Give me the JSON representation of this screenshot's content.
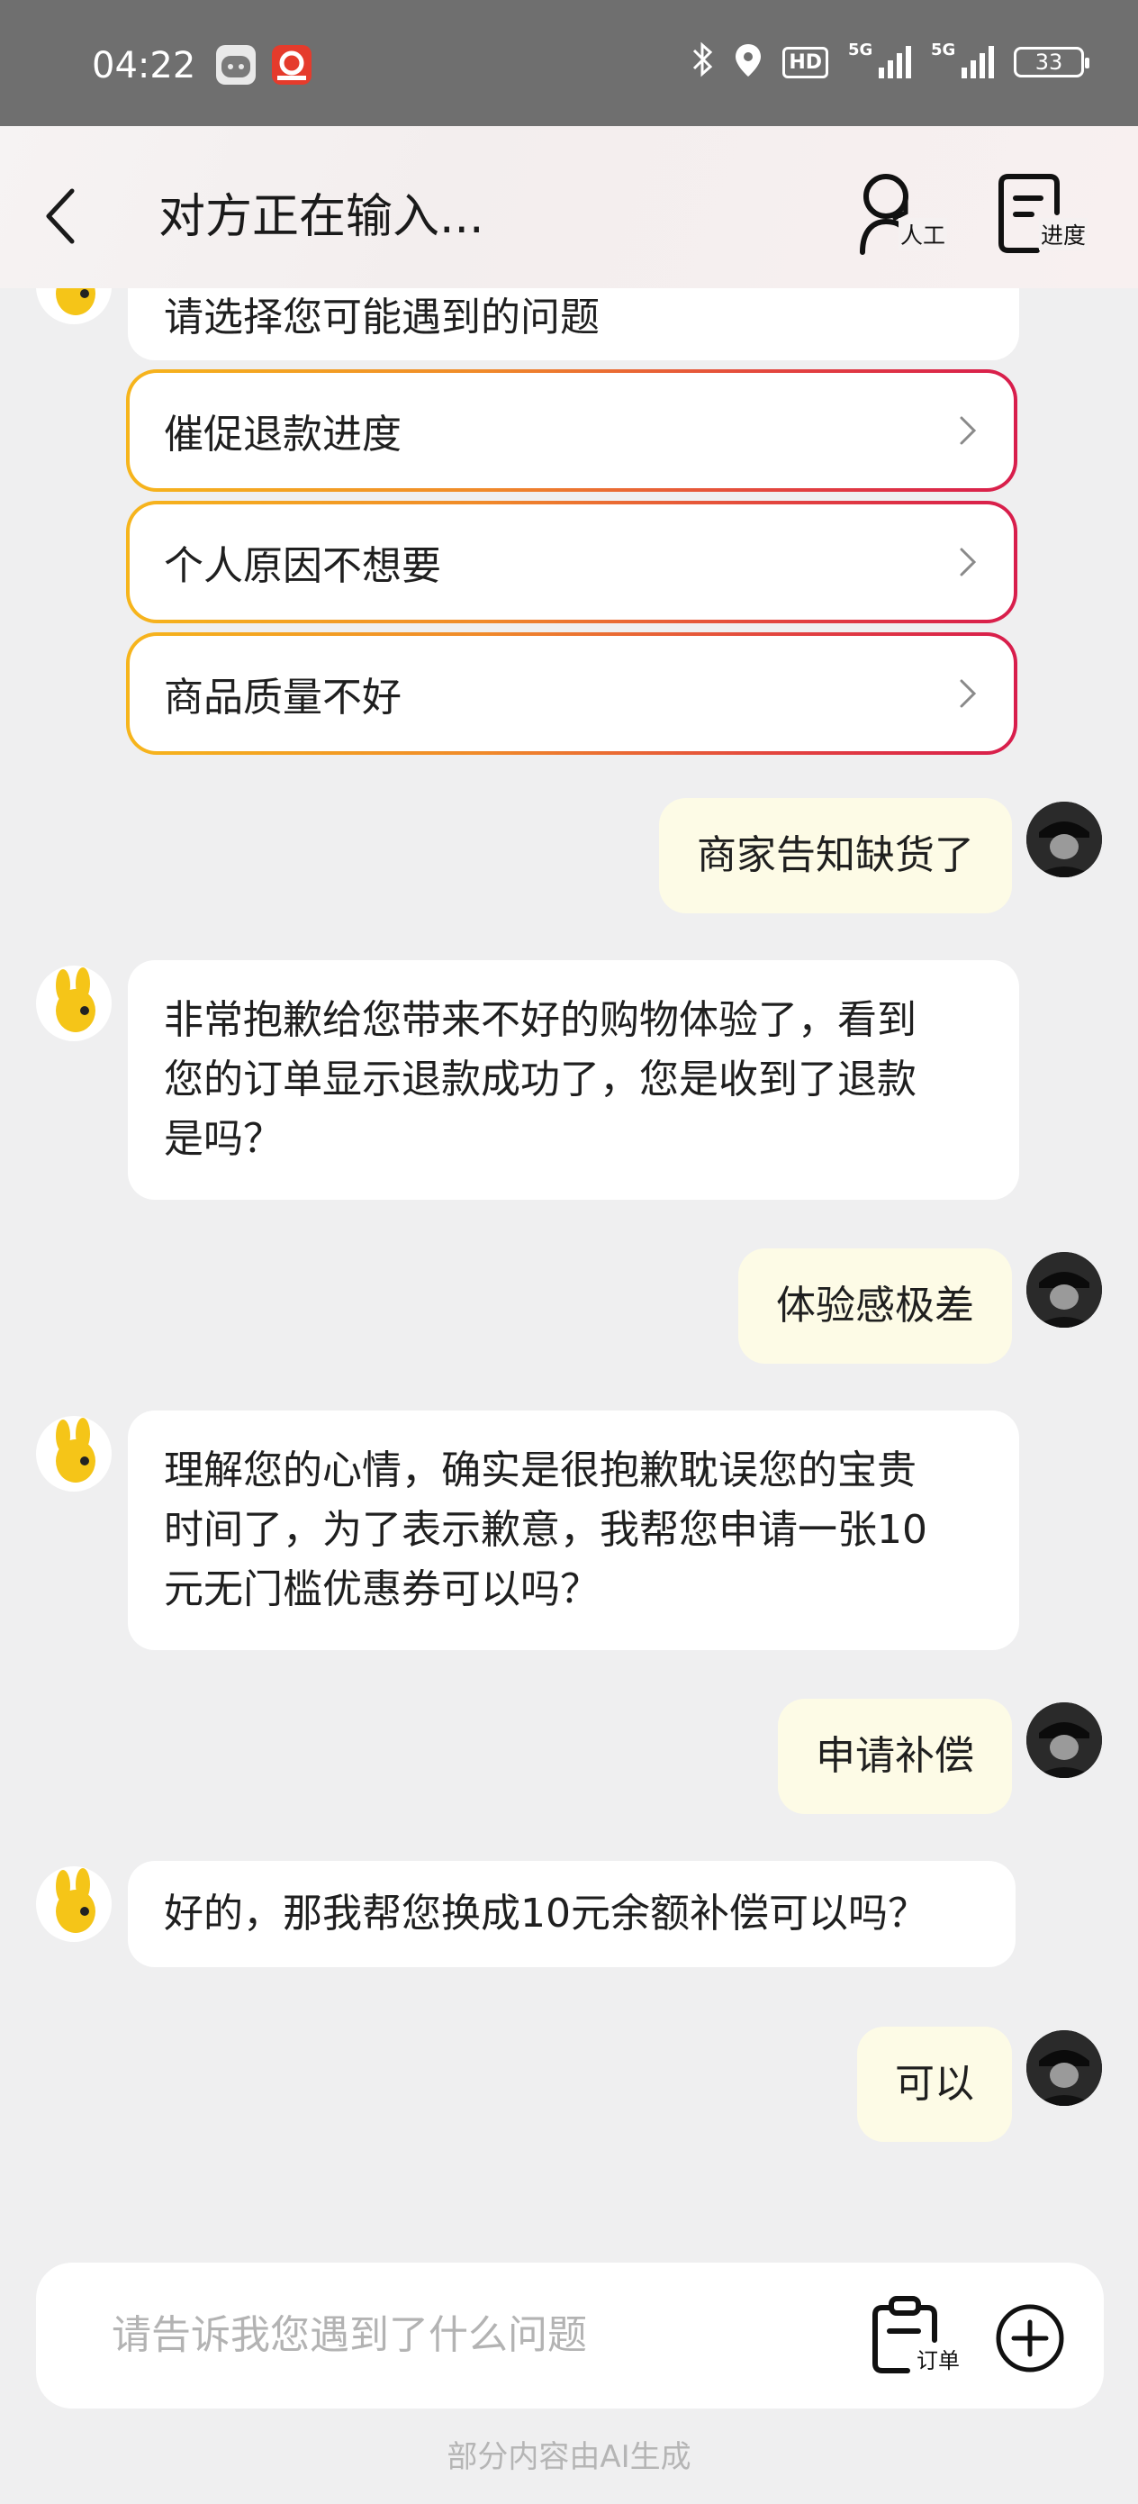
{
  "status_bar": {
    "time": "04:22",
    "network_1": "5G",
    "network_2": "5G",
    "hd_label": "HD",
    "battery": "33",
    "icons": [
      "app-icon-robot",
      "app-icon-red-c",
      "bluetooth-icon",
      "location-icon",
      "signal-icon",
      "battery-icon"
    ]
  },
  "header": {
    "title": "对方正在输入...",
    "human_agent_label": "人工",
    "progress_label": "进度"
  },
  "chat": {
    "truncated_prompt": "请选择您可能遇到的问题",
    "options": [
      {
        "label": "催促退款进度"
      },
      {
        "label": "个人原因不想要"
      },
      {
        "label": "商品质量不好"
      }
    ],
    "messages": [
      {
        "from": "user",
        "text": "商家告知缺货了"
      },
      {
        "from": "bot",
        "lines": [
          "非常抱歉给您带来不好的购物体验了，看到",
          "您的订单显示退款成功了，您是收到了退款",
          "是吗？"
        ]
      },
      {
        "from": "user",
        "text": "体验感极差"
      },
      {
        "from": "bot",
        "lines": [
          "理解您的心情，确实是很抱歉耽误您的宝贵",
          "时间了，为了表示歉意，我帮您申请一张10",
          "元无门槛优惠券可以吗？"
        ]
      },
      {
        "from": "user",
        "text": "申请补偿"
      },
      {
        "from": "bot",
        "lines": [
          "好的，那我帮您换成10元余额补偿可以吗？"
        ]
      },
      {
        "from": "user",
        "text": "可以"
      }
    ]
  },
  "input": {
    "placeholder": "请告诉我您遇到了什么问题",
    "order_label": "订单"
  },
  "footer_note": "部分内容由AI生成",
  "colors": {
    "option_gradient_start": "#f6b51c",
    "option_gradient_end": "#d81d4c",
    "user_bubble": "#fdfbe6",
    "page_bg": "#efeff0"
  }
}
